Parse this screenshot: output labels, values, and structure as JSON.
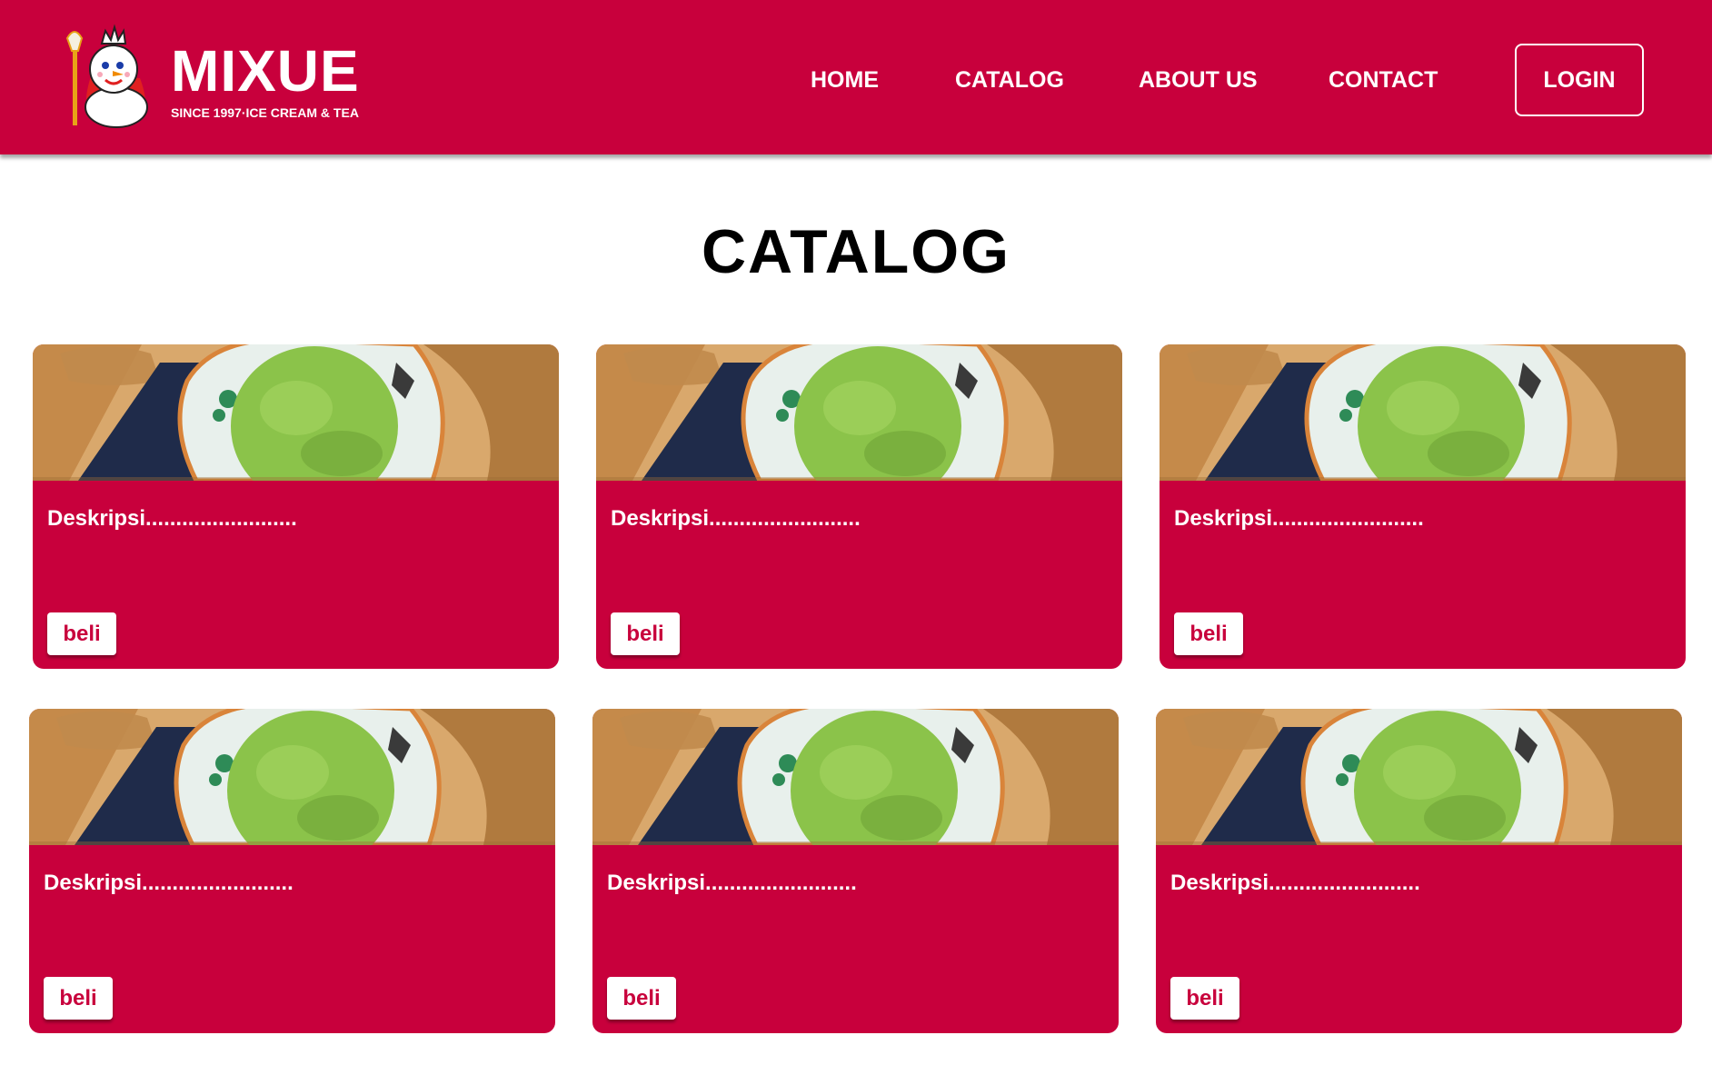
{
  "colors": {
    "brand": "#C8003C",
    "ice_cream": "#8BC34A",
    "wood": "#D9A86C"
  },
  "brand": {
    "title": "MIXUE",
    "subtitle": "SINCE 1997·ICE CREAM & TEA",
    "mascot_icon": "snowman-mascot-icon"
  },
  "nav": {
    "links": [
      "HOME",
      "CATALOG",
      "ABOUT US",
      "CONTACT"
    ],
    "login_label": "LOGIN"
  },
  "main": {
    "title": "CATALOG",
    "products": [
      {
        "description": "Deskripsi.........................",
        "button_label": "beli",
        "image_icon": "matcha-ice-cream-image"
      },
      {
        "description": "Deskripsi.........................",
        "button_label": "beli",
        "image_icon": "matcha-ice-cream-image"
      },
      {
        "description": "Deskripsi.........................",
        "button_label": "beli",
        "image_icon": "matcha-ice-cream-image"
      },
      {
        "description": "Deskripsi.........................",
        "button_label": "beli",
        "image_icon": "matcha-ice-cream-image"
      },
      {
        "description": "Deskripsi.........................",
        "button_label": "beli",
        "image_icon": "matcha-ice-cream-image"
      },
      {
        "description": "Deskripsi.........................",
        "button_label": "beli",
        "image_icon": "matcha-ice-cream-image"
      }
    ]
  }
}
